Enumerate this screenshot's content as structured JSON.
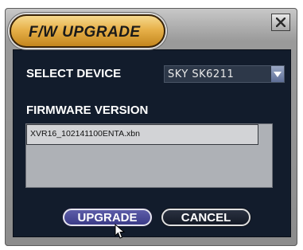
{
  "dialog": {
    "title": "F/W UPGRADE",
    "close_icon": "close-x-icon"
  },
  "select_device": {
    "label": "SELECT DEVICE",
    "value": "SKY SK6211",
    "arrow_icon": "dropdown-arrow-icon"
  },
  "firmware": {
    "label": "FIRMWARE VERSION",
    "files": [
      "XVR16_102141100ENTA.xbn"
    ]
  },
  "buttons": {
    "upgrade": "UPGRADE",
    "cancel": "CANCEL"
  },
  "pointer_icon": "mouse-pointer-icon"
}
